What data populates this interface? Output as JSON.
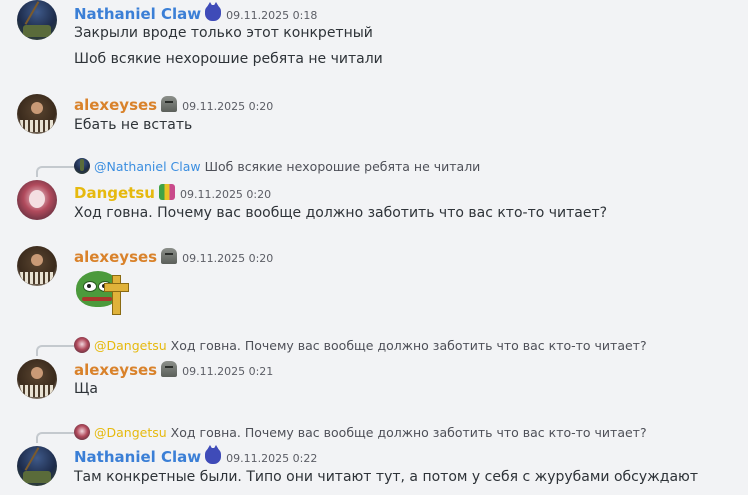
{
  "messages": [
    {
      "author": "Nathaniel Claw",
      "timestamp": "09.11.2025 0:18",
      "lines": [
        "Закрыли вроде только этот конкретный",
        "Шоб всякие нехорошие ребята не читали"
      ]
    },
    {
      "author": "alexeyses",
      "timestamp": "09.11.2025 0:20",
      "lines": [
        "Ебать не встать"
      ]
    },
    {
      "reply": {
        "mention": "@Nathaniel Claw",
        "text": "Шоб всякие нехорошие ребята не читали"
      },
      "author": "Dangetsu",
      "timestamp": "09.11.2025 0:20",
      "lines": [
        "Ход говна. Почему вас вообще должно заботить что вас кто-то читает?"
      ]
    },
    {
      "author": "alexeyses",
      "timestamp": "09.11.2025 0:20",
      "sticker": "pepe-cross-sticker"
    },
    {
      "reply": {
        "mention": "@Dangetsu",
        "text": "Ход говна. Почему вас вообще должно заботить что вас кто-то читает?"
      },
      "author": "alexeyses",
      "timestamp": "09.11.2025 0:21",
      "lines": [
        "Ща"
      ]
    },
    {
      "reply": {
        "mention": "@Dangetsu",
        "text": "Ход говна. Почему вас вообще должно заботить что вас кто-то читает?"
      },
      "author": "Nathaniel Claw",
      "timestamp": "09.11.2025 0:22",
      "lines": [
        "Там конкретные были. Типо они читают тут, а потом у себя с журубами обсуждают"
      ]
    }
  ],
  "colors": {
    "background": "#f2f3f5",
    "nathaniel": "#3b7fd6",
    "alexeyses": "#d9822b",
    "dangetsu": "#e6b90e",
    "mention": "#3b8ee0"
  }
}
